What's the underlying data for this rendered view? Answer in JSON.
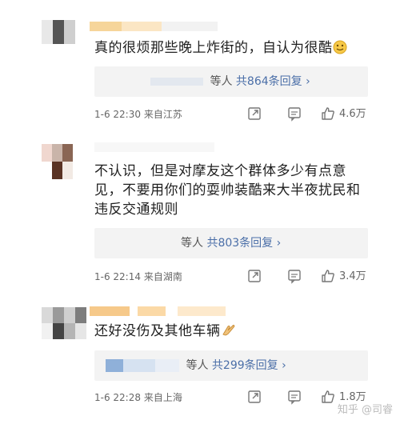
{
  "comments": [
    {
      "text": "真的很烦那些晚上炸街的，自认为很酷",
      "reply_who": "等人",
      "reply_count": "共864条回复 ›",
      "time": "1-6 22:30",
      "location": "来自江苏",
      "likes": "4.6万"
    },
    {
      "text": "不认识，但是对摩友这个群体多少有点意见，不要用你们的耍帅装酷来大半夜扰民和违反交通规则",
      "reply_who": "等人",
      "reply_count": "共803条回复 ›",
      "time": "1-6 22:14",
      "location": "来自湖南",
      "likes": "3.4万"
    },
    {
      "text": "还好没伤及其他车辆",
      "reply_who": "等人",
      "reply_count": "共299条回复 ›",
      "time": "1-6 22:28",
      "location": "来自上海",
      "likes": "1.8万"
    }
  ],
  "watermark": "知乎 @司睿",
  "icons": [
    "share-icon",
    "comment-icon",
    "like-icon",
    "smile-emoji",
    "clap-emoji"
  ],
  "colors": {
    "reply_count": "#4b6fa8",
    "meta_text": "#666666",
    "reply_bg": "#f3f3f3"
  }
}
